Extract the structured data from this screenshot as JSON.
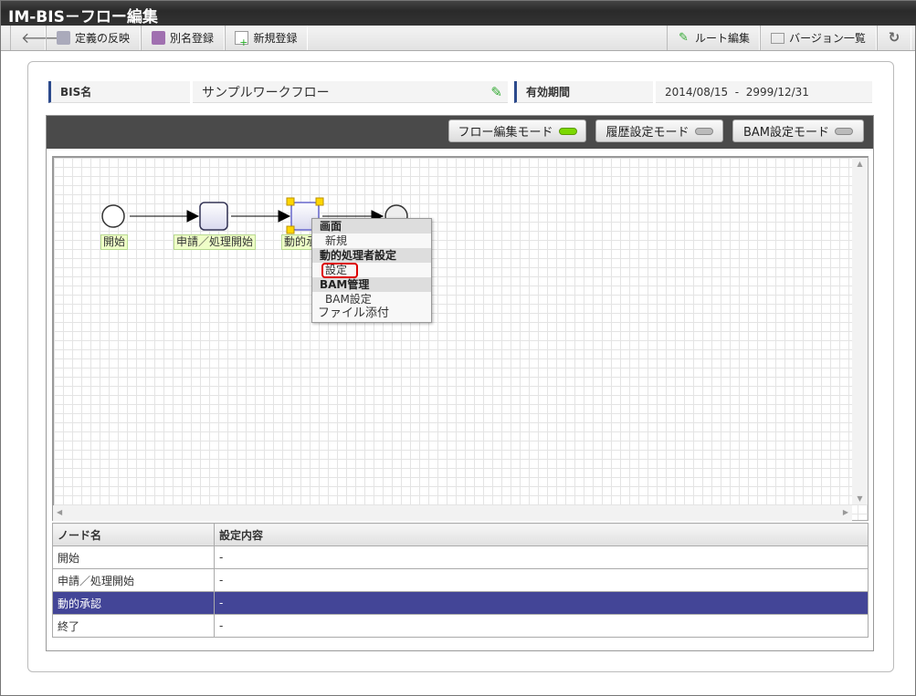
{
  "title": "IM-BIS－フロー編集",
  "toolbar": {
    "back": "back",
    "reflect": "定義の反映",
    "save_as": "別名登録",
    "new": "新規登録",
    "route_edit": "ルート編集",
    "version_list": "バージョン一覧"
  },
  "info": {
    "bis_name_label": "BIS名",
    "bis_name": "サンプルワークフロー",
    "period_label": "有効期間",
    "period": "2014/08/15  -  2999/12/31"
  },
  "modes": [
    {
      "label": "フロー編集モード",
      "active": true
    },
    {
      "label": "履歴設定モード",
      "active": false
    },
    {
      "label": "BAM設定モード",
      "active": false
    }
  ],
  "nodes": {
    "start": "開始",
    "apply": "申請／処理開始",
    "dynamic": "動的承認"
  },
  "context_menu": {
    "h1": "画面",
    "i1": "新規",
    "h2": "動的処理者設定",
    "i2": "設定",
    "h3": "BAM管理",
    "i3": "BAM設定",
    "i4": "ファイル添付"
  },
  "table": {
    "headers": [
      "ノード名",
      "設定内容"
    ],
    "rows": [
      [
        "開始",
        "-"
      ],
      [
        "申請／処理開始",
        "-"
      ],
      [
        "動的承認",
        "-"
      ],
      [
        "終了",
        "-"
      ]
    ],
    "selected_index": 2
  },
  "colors": {
    "selected_row": "#434597",
    "active_led": "#7cd800"
  }
}
